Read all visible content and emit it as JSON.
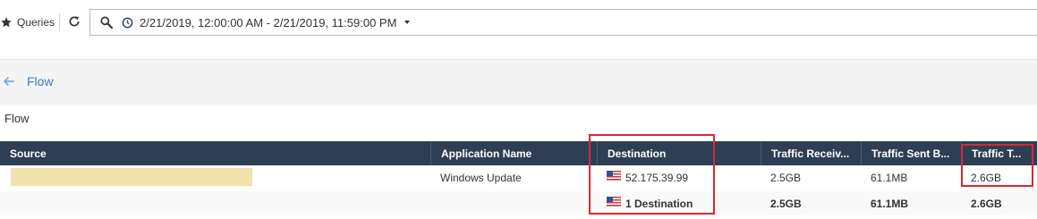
{
  "toolbar": {
    "queries_label": "Queries",
    "time_range": "2/21/2019, 12:00:00 AM - 2/21/2019, 11:59:00 PM"
  },
  "icons": {
    "queries": "star-icon",
    "refresh": "refresh-icon",
    "search": "search-icon",
    "clock": "clock-icon",
    "dropdown": "caret-down-icon",
    "back": "arrow-left-icon",
    "flag": "us-flag-icon"
  },
  "breadcrumb": {
    "label": "Flow"
  },
  "section": {
    "title": "Flow"
  },
  "table": {
    "columns": [
      "Source",
      "Application Name",
      "Destination",
      "Traffic Receiv...",
      "Traffic Sent B...",
      "Traffic T..."
    ],
    "rows": [
      {
        "source": "",
        "application": "Windows Update",
        "destination": "52.175.39.99",
        "received": "2.5GB",
        "sent": "61.1MB",
        "total": "2.6GB"
      }
    ],
    "summary": {
      "destination": "1 Destination",
      "received": "2.5GB",
      "sent": "61.1MB",
      "total": "2.6GB"
    }
  },
  "colors": {
    "header_bg": "#2e3f55",
    "link": "#3c7cc0",
    "highlight_box": "#d42a33",
    "redaction": "#efe2ab"
  }
}
